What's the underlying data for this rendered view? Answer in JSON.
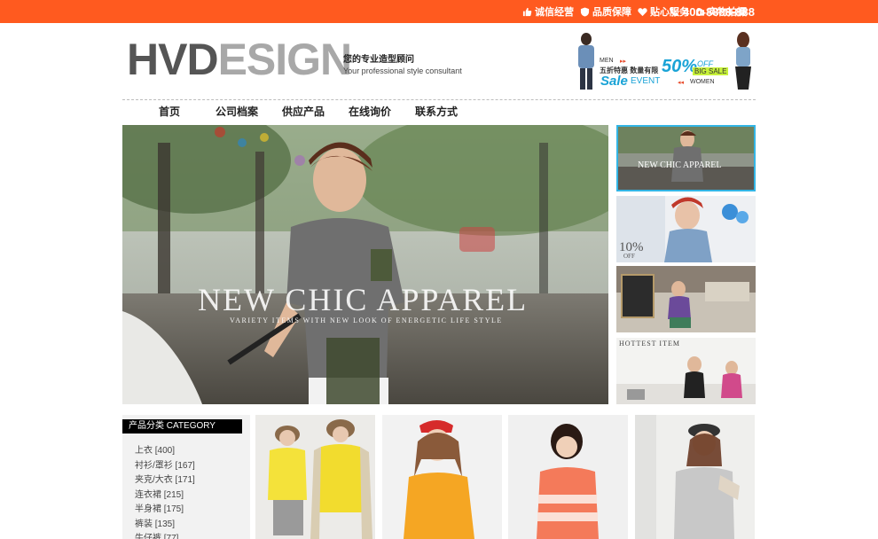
{
  "topbar": {
    "items": [
      {
        "label": "诚信经营",
        "icon": "thumbs-up-icon"
      },
      {
        "label": "品质保障",
        "icon": "shield-icon"
      },
      {
        "label": "贴心服务",
        "icon": "heart-icon"
      },
      {
        "label": "实物拍摄",
        "icon": "camera-icon"
      }
    ],
    "phone": "400-8888-888",
    "phone_icon": "phone-icon",
    "color": "#ff5a1f"
  },
  "header": {
    "logo_part1": "HVD",
    "logo_part2": "ESIGN",
    "tagline_cn": "您的专业造型顾问",
    "tagline_en": "Your professional style consultant"
  },
  "ad": {
    "men": "MEN",
    "line1": "五折特惠 数量有限",
    "sale": "Sale",
    "event": "EVENT",
    "percent": "50%",
    "off": "OFF",
    "big_sale": "BIG SALE",
    "women": "WOMEN"
  },
  "nav": [
    "首页",
    "公司档案",
    "供应产品",
    "在线询价",
    "联系方式"
  ],
  "hero": {
    "title": "NEW CHIC APPAREL",
    "subtitle": "VARIETY ITEMS WITH NEW LOOK OF ENERGETIC LIFE STYLE"
  },
  "thumbs": {
    "t1": "NEW CHIC APPAREL",
    "t2": "10%",
    "t2b": "OFF",
    "t4": "HOTTEST ITEM"
  },
  "category": {
    "title": "产品分类  CATEGORY",
    "items": [
      "上衣 [400]",
      "衬衫/罩衫 [167]",
      "夹克/大衣 [171]",
      "连衣裙 [215]",
      "半身裙 [175]",
      "裤装 [135]",
      "牛仔裤 [77]"
    ]
  }
}
